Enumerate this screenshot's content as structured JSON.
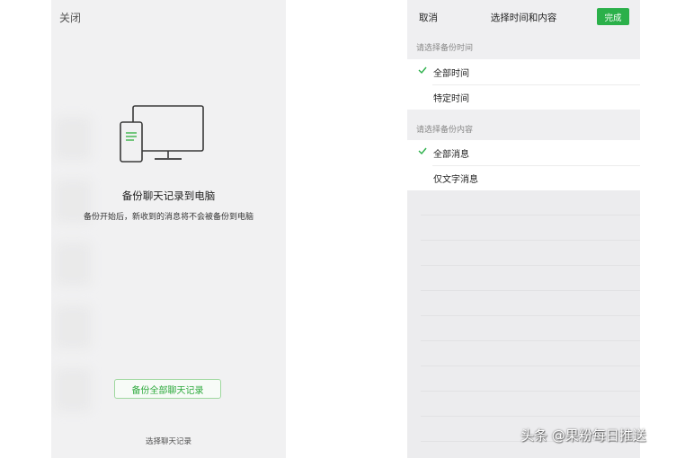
{
  "left": {
    "close_label": "关闭",
    "title": "备份聊天记录到电脑",
    "description": "备份开始后，新收到的消息将不会被备份到电脑",
    "backup_all_button": "备份全部聊天记录",
    "choose_link": "选择聊天记录",
    "icons": [
      "phone-icon",
      "monitor-icon"
    ]
  },
  "right": {
    "cancel_label": "取消",
    "title": "选择时间和内容",
    "done_label": "完成",
    "time_section": {
      "header": "请选择备份时间",
      "options": [
        {
          "label": "全部时间",
          "selected": true
        },
        {
          "label": "特定时间",
          "selected": false
        }
      ]
    },
    "content_section": {
      "header": "请选择备份内容",
      "options": [
        {
          "label": "全部消息",
          "selected": true
        },
        {
          "label": "仅文字消息",
          "selected": false
        }
      ]
    }
  },
  "watermark": "头条 @果粉每日推送",
  "colors": {
    "accent_green": "#2bb04a",
    "background": "#f1f1f2",
    "option_bg": "#ffffff"
  }
}
